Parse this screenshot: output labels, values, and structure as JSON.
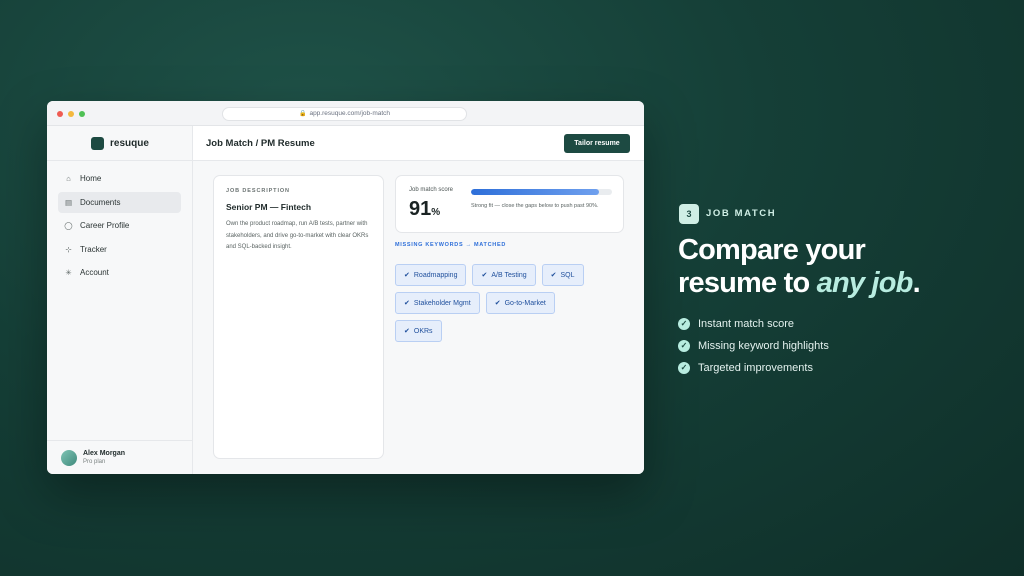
{
  "browser": {
    "url": "app.resuque.com/job-match"
  },
  "app": {
    "name": "resuque"
  },
  "sidebar": {
    "items": [
      {
        "label": "Home",
        "icon": "home-icon"
      },
      {
        "label": "Documents",
        "icon": "document-icon",
        "active": true
      },
      {
        "label": "Career Profile",
        "icon": "user-icon"
      },
      {
        "label": "Tracker",
        "icon": "tracker-icon"
      },
      {
        "label": "Account",
        "icon": "gear-icon"
      }
    ],
    "user": {
      "name": "Alex Morgan",
      "plan": "Pro plan"
    }
  },
  "header": {
    "title": "Job Match / PM Resume",
    "action_label": "Tailor resume"
  },
  "job": {
    "section_label": "JOB DESCRIPTION",
    "title": "Senior PM — Fintech",
    "description": "Own the product roadmap, run A/B tests, partner with stakeholders, and drive go-to-market with clear OKRs and SQL-backed insight."
  },
  "score": {
    "label": "Job match score",
    "value": "91",
    "unit": "%",
    "progress_fraction": 0.91,
    "note": "Strong fit — close the gaps below to push past 90%."
  },
  "keywords": {
    "label": "MISSING KEYWORDS → MATCHED",
    "rows": [
      [
        "Roadmapping",
        "A/B Testing",
        "SQL"
      ],
      [
        "Stakeholder Mgmt",
        "Go-to-Market"
      ],
      [
        "OKRs"
      ]
    ]
  },
  "promo": {
    "step_number": "3",
    "step_label": "JOB MATCH",
    "headline_line1": "Compare your",
    "headline_line2_start": "resume to ",
    "headline_emphasis": "any job",
    "headline_end": ".",
    "features": [
      "Instant match score",
      "Missing keyword highlights",
      "Targeted improvements"
    ]
  },
  "colors": {
    "background": "#153f37",
    "brand": "#1d4a42",
    "accent_blue": "#2e6fd9",
    "mint": "#b8ece0"
  }
}
